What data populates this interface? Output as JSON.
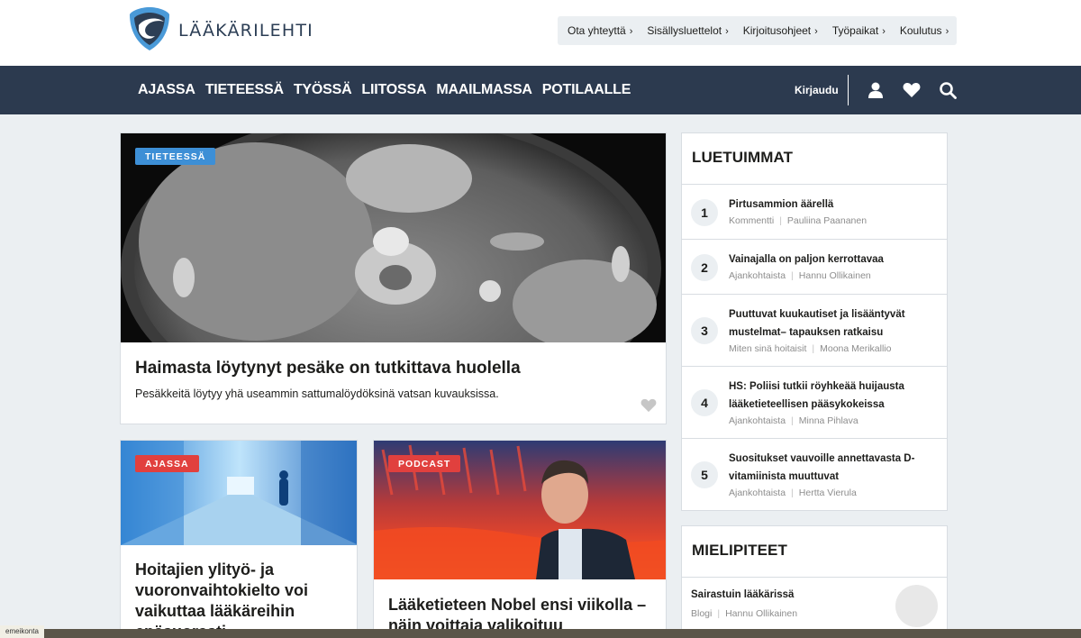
{
  "brand": {
    "name": "LÄÄKÄRILEHTI"
  },
  "utility_nav": [
    {
      "label": "Ota yhteyttä"
    },
    {
      "label": "Sisällysluettelot"
    },
    {
      "label": "Kirjoitusohjeet"
    },
    {
      "label": "Työpaikat"
    },
    {
      "label": "Koulutus"
    }
  ],
  "utility_chevron": "›",
  "main_nav": [
    {
      "label": "AJASSA"
    },
    {
      "label": "TIETEESSÄ"
    },
    {
      "label": "TYÖSSÄ"
    },
    {
      "label": "LIITOSSA"
    },
    {
      "label": "MAAILMASSA"
    },
    {
      "label": "POTILAALLE"
    }
  ],
  "nav_right": {
    "login_label": "Kirjaudu"
  },
  "hero": {
    "tag": "TIETEESSÄ",
    "title": "Haimasta löytynyt pesäke on tutkittava huolella",
    "lead": "Pesäkkeitä löytyy yhä useammin sattumalöydöksinä vatsan kuvauksissa."
  },
  "card_left": {
    "tag": "AJASSA",
    "title_lines": [
      "Hoitajien ylityö- ja",
      "vuoronvaihtokielto voi",
      "vaikuttaa lääkäreihin",
      "epäsuorasti"
    ]
  },
  "card_right": {
    "tag": "PODCAST",
    "title_lines": [
      "Lääketieteen Nobel ensi viikolla –",
      "näin voittaja valikoituu"
    ]
  },
  "most_read": {
    "heading": "LUETUIMMAT",
    "items": [
      {
        "rank": "1",
        "title": "Pirtusammion äärellä",
        "category": "Kommentti",
        "author": "Pauliina Paananen"
      },
      {
        "rank": "2",
        "title": "Vainajalla on paljon kerrottavaa",
        "category": "Ajankohtaista",
        "author": "Hannu Ollikainen"
      },
      {
        "rank": "3",
        "title": "Puuttuvat kuukautiset ja lisääntyvät mustelmat– tapauksen ratkaisu",
        "category": "Miten sinä hoitaisit",
        "author": "Moona Merikallio"
      },
      {
        "rank": "4",
        "title": "HS: Poliisi tutkii röyhkeää huijausta lääketieteellisen pääsykokeissa",
        "category": "Ajankohtaista",
        "author": "Minna Pihlava"
      },
      {
        "rank": "5",
        "title": "Suositukset vauvoille annettavasta D-vitamiinista muuttuvat",
        "category": "Ajankohtaista",
        "author": "Hertta Vierula"
      }
    ]
  },
  "opinions": {
    "heading": "MIELIPITEET",
    "items": [
      {
        "title": "Sairastuin lääkärissä",
        "category": "Blogi",
        "author": "Hannu Ollikainen"
      }
    ]
  },
  "meta_separator": "|",
  "status_tip": "emeikonta",
  "colors": {
    "navy": "#2c3a4f",
    "accent_blue": "#3d8fd6",
    "accent_red": "#e1403e",
    "page_bg": "#ebeff2"
  },
  "icons": [
    "logo-icon",
    "chevron-right-icon",
    "user-icon",
    "heart-icon",
    "search-icon"
  ]
}
